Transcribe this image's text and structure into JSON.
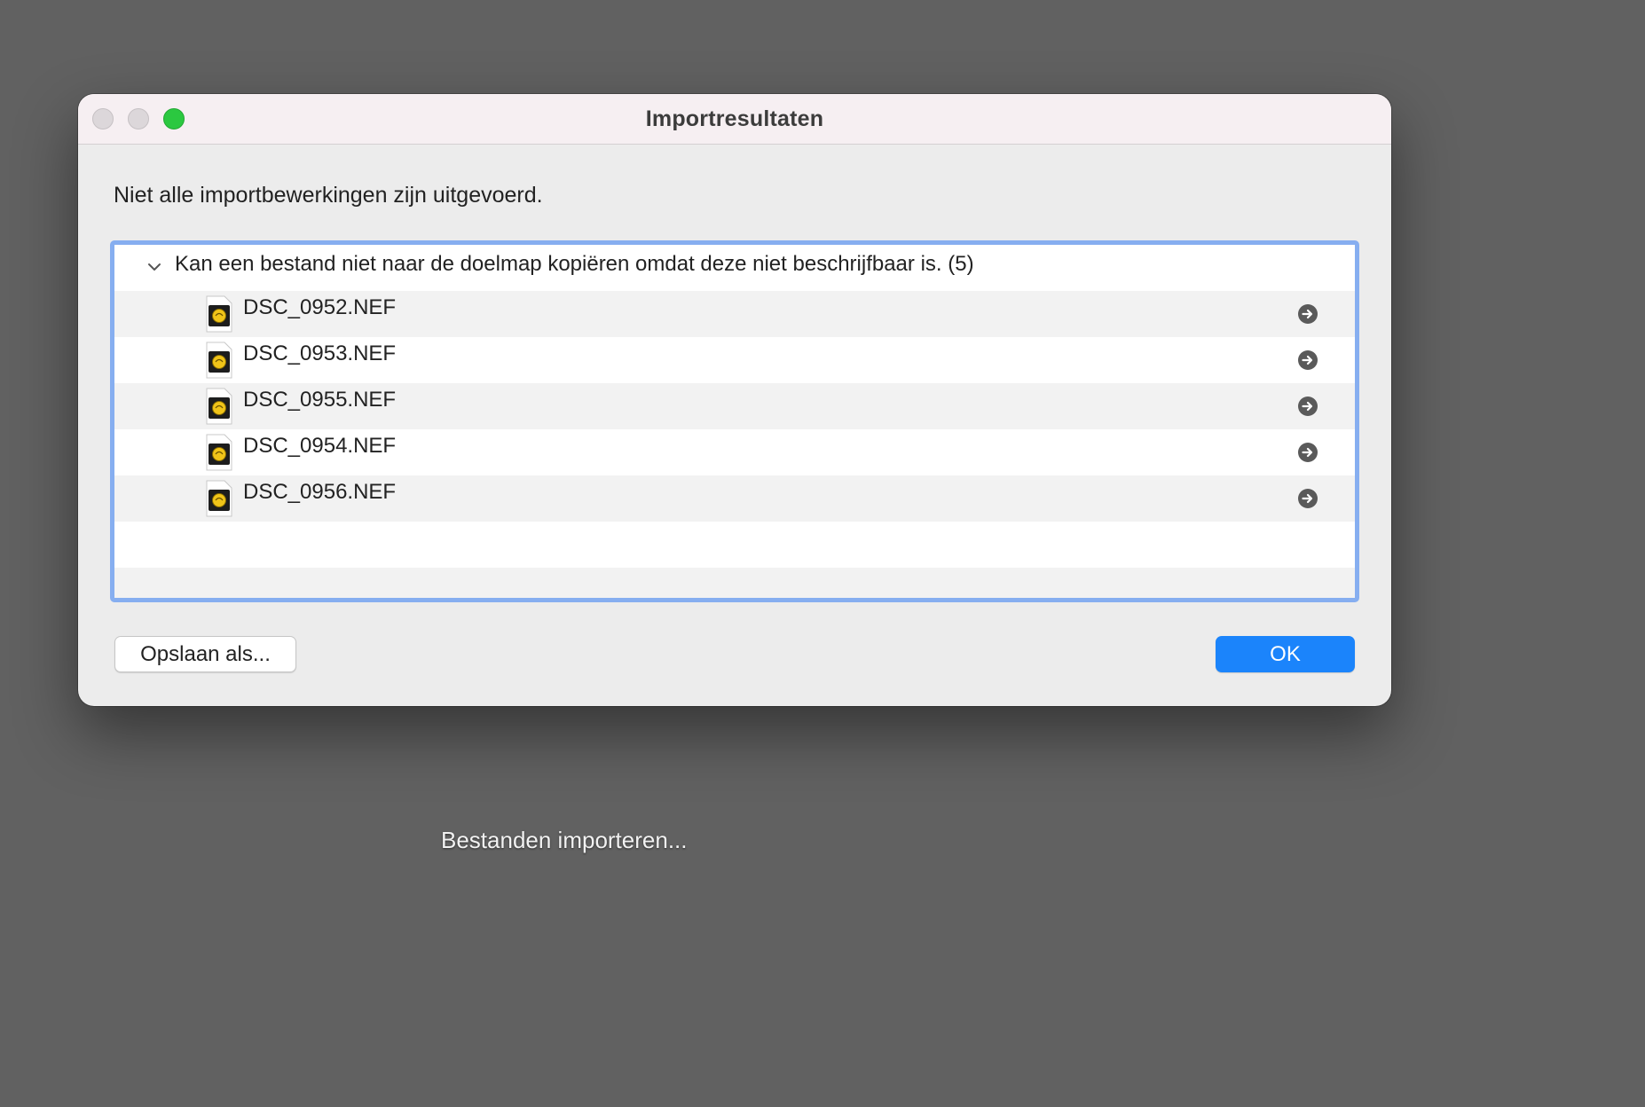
{
  "window": {
    "title": "Importresultaten",
    "controls": {
      "close_icon": "close-icon",
      "minimize_icon": "minimize-icon",
      "zoom_icon": "zoom-icon"
    }
  },
  "message": "Niet alle importbewerkingen zijn uitgevoerd.",
  "results": {
    "group": {
      "label": "Kan een bestand niet naar de doelmap kopiëren omdat deze niet beschrijfbaar is. (5)",
      "expanded": true,
      "icon": "chevron-down-icon"
    },
    "files": [
      {
        "name": "DSC_0952.NEF",
        "icon": "raw-file-icon",
        "action_icon": "arrow-right-circle-icon"
      },
      {
        "name": "DSC_0953.NEF",
        "icon": "raw-file-icon",
        "action_icon": "arrow-right-circle-icon"
      },
      {
        "name": "DSC_0955.NEF",
        "icon": "raw-file-icon",
        "action_icon": "arrow-right-circle-icon"
      },
      {
        "name": "DSC_0954.NEF",
        "icon": "raw-file-icon",
        "action_icon": "arrow-right-circle-icon"
      },
      {
        "name": "DSC_0956.NEF",
        "icon": "raw-file-icon",
        "action_icon": "arrow-right-circle-icon"
      }
    ]
  },
  "buttons": {
    "save_as": "Opslaan als...",
    "ok": "OK"
  },
  "background_status": "Bestanden importeren...",
  "colors": {
    "backdrop": "#616161",
    "dialog": "#ececec",
    "titlebar": "#f6eff2",
    "focus_ring": "#86aef0",
    "accent_button": "#1b84fb",
    "zoom_button": "#2bc840"
  }
}
